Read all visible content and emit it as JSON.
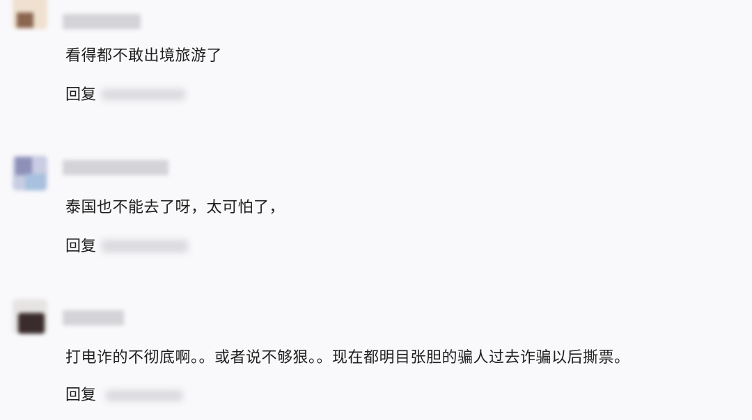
{
  "comments": [
    {
      "content": "看得都不敢出境旅游了",
      "reply_label": "回复",
      "avatar_colors": [
        "#e9d7c5",
        "#8a6550",
        "#f0e4d6"
      ]
    },
    {
      "content": "泰国也不能去了呀，太可怕了，",
      "reply_label": "回复",
      "avatar_colors": [
        "#bfc3dc",
        "#8e90b8",
        "#a7c1de"
      ]
    },
    {
      "content": "打电诈的不彻底啊。。或者说不够狠。。现在都明目张胆的骗人过去诈骗以后撕票。",
      "reply_label": "回复",
      "avatar_colors": [
        "#e6e4e3",
        "#3a2c2c",
        "#cfcaca"
      ]
    }
  ]
}
